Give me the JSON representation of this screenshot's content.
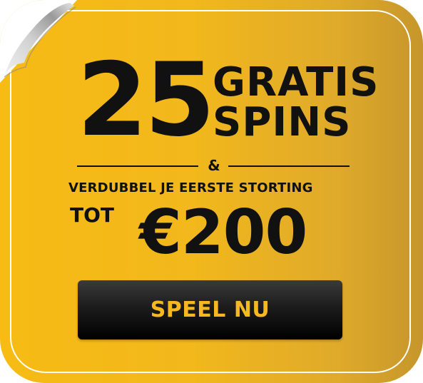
{
  "colors": {
    "badge_yellow": "#f7bb14",
    "badge_gold_dark": "#c6962b",
    "text_black": "#111111",
    "border_white": "#ffffff",
    "button_black": "#000000",
    "button_text_yellow": "#f5b820",
    "curl_silver": "#c9c9c9"
  },
  "icons": {
    "corner": "page-curl-icon"
  },
  "headline": {
    "number": "25",
    "line1": "GRATIS",
    "line2": "SPINS"
  },
  "separator": "&",
  "subline": "VERDUBBEL JE EERSTE STORTING",
  "tot_label": "TOT",
  "amount": "€200",
  "cta": {
    "label": "SPEEL NU"
  }
}
